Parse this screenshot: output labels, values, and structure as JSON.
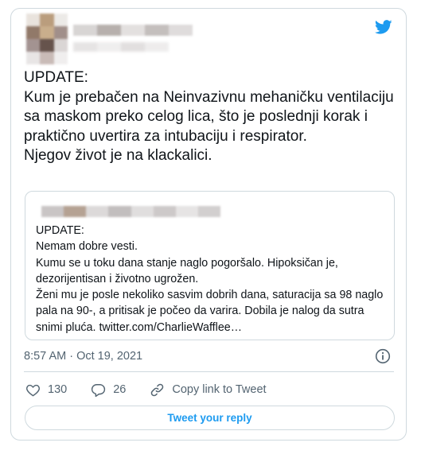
{
  "tweet": {
    "text": "UPDATE:\nKum je prebačen na Neinvazivnu mehaničku ventilaciju sa maskom preko celog lica, što je poslednji korak i praktično uvertira za intubaciju i respirator.\nNjegov život je na klackalici.",
    "timestamp": "8:57 AM · Oct 19, 2021"
  },
  "quoted_tweet": {
    "text": "UPDATE:\nNemam dobre vesti.\nKumu se u toku dana stanje naglo pogoršalo. Hipoksičan je, dezorijentisan i životno ugrožen.\nŽeni mu je posle nekoliko sasvim dobrih dana, saturacija sa 98 naglo pala na 90-, a pritisak je počeo da varira. Dobila je nalog da sutra snimi pluća. twitter.com/CharlieWafflee…"
  },
  "actions": {
    "likes": "130",
    "replies": "26",
    "copy_link": "Copy link to Tweet"
  },
  "reply_button": "Tweet your reply",
  "colors": {
    "accent": "#1d9bf0",
    "muted": "#536471",
    "border": "#cfd9de",
    "text": "#0f1419"
  },
  "icons": [
    "twitter-bird-icon",
    "info-icon",
    "heart-icon",
    "reply-bubble-icon",
    "link-icon"
  ]
}
